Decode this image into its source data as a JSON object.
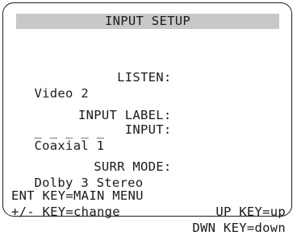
{
  "screen": {
    "title": "INPUT SETUP",
    "listen": {
      "label": "LISTEN:",
      "value": "Video 2"
    },
    "input_label": {
      "label": "INPUT LABEL:",
      "value": "_ _ _ _ _"
    },
    "input": {
      "label": "INPUT:",
      "value": "Coaxial 1"
    },
    "surr_mode": {
      "label": "SURR MODE:",
      "value": "Dolby 3 Stereo"
    },
    "footer": {
      "line1_left": "ENT KEY=MAIN MENU",
      "line1_right": "UP KEY=up",
      "line2_left": "+/- KEY=change",
      "line2_right": "DWN KEY=down"
    }
  }
}
